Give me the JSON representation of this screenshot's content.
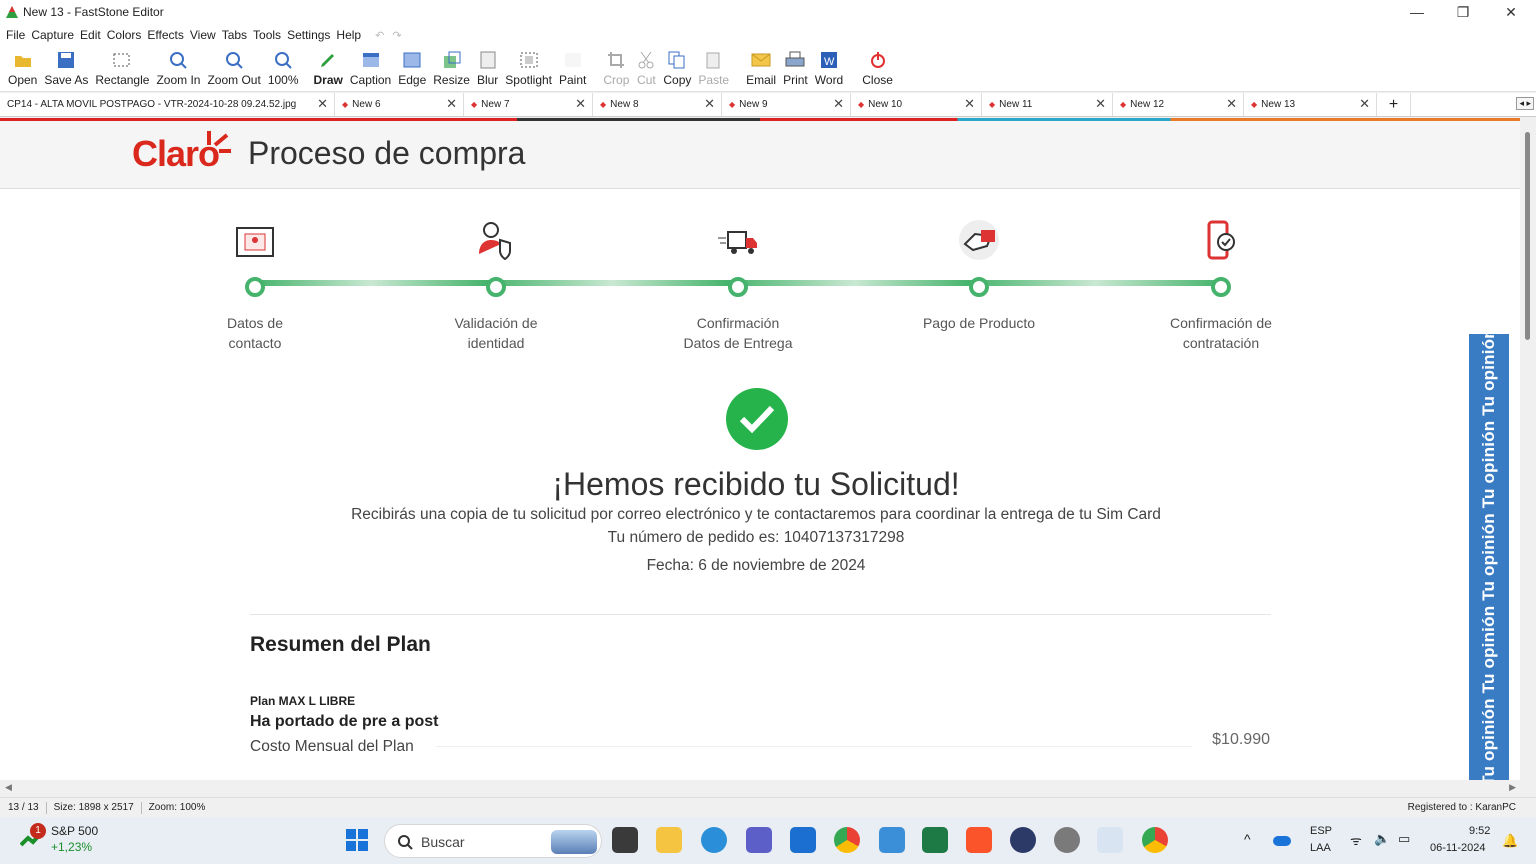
{
  "window": {
    "title": "New 13 - FastStone Editor"
  },
  "menu": [
    "File",
    "Capture",
    "Edit",
    "Colors",
    "Effects",
    "View",
    "Tabs",
    "Tools",
    "Settings",
    "Help"
  ],
  "toolbar": [
    "Open",
    "Save As",
    "Rectangle",
    "Zoom In",
    "Zoom Out",
    "100%",
    "Draw",
    "Caption",
    "Edge",
    "Resize",
    "Blur",
    "Spotlight",
    "Paint",
    "Crop",
    "Cut",
    "Copy",
    "Paste",
    "Email",
    "Print",
    "Word",
    "Close"
  ],
  "tabs": [
    "CP14 - ALTA MOVIL POSTPAGO - VTR-2024-10-28 09.24.52.jpg",
    "New 6",
    "New 7",
    "New 8",
    "New 9",
    "New 10",
    "New 11",
    "New 12",
    "New 13"
  ],
  "page": {
    "title": "Proceso de compra",
    "logo": "Claro",
    "steps": [
      "Datos de\ncontacto",
      "Validación de\nidentidad",
      "Confirmación\nDatos de Entrega",
      "Pago de Producto",
      "Confirmación de\ncontratación"
    ],
    "heading": "¡Hemos recibido tu Solicitud!",
    "line1": "Recibirás una copia de tu solicitud por correo electrónico y te contactaremos para coordinar la entrega de tu Sim Card",
    "line2": "Tu número de pedido es: 10407137317298",
    "line3": "Fecha: 6 de noviembre de 2024",
    "resumen": "Resumen del Plan",
    "plan": "Plan MAX L LIBRE",
    "portado": "Ha portado de pre a post",
    "costo": "Costo Mensual del Plan",
    "price": "$10.990",
    "opinion": "Tu opinión  Tu opinión  Tu opinión  Tu opinión  Tu opinión"
  },
  "status": {
    "pages": "13 / 13",
    "size": "Size: 1898 x 2517",
    "zoom": "Zoom: 100%",
    "registered": "Registered to : KaranPC"
  },
  "taskbar": {
    "stock_name": "S&P 500",
    "stock_change": "+1,23%",
    "badge": "1",
    "search": "Buscar",
    "lang1": "ESP",
    "lang2": "LAA",
    "time": "9:52",
    "date": "06-11-2024"
  }
}
